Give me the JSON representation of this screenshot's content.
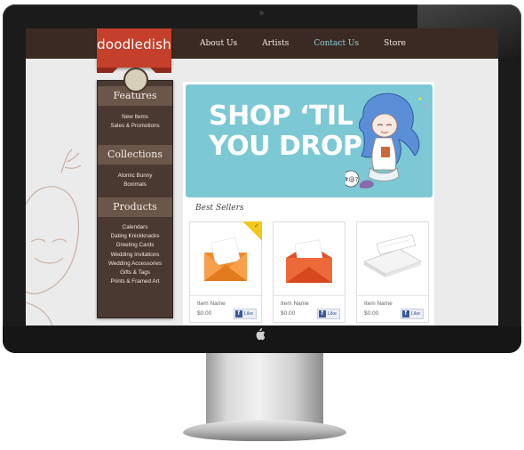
{
  "brand": {
    "logo_text": "doodledish"
  },
  "nav": {
    "items": [
      "About Us",
      "Artists",
      "Contact Us",
      "Store"
    ],
    "active": "Contact Us"
  },
  "sidebar": {
    "sections": [
      {
        "title": "Features",
        "items": [
          "New Items",
          "Sales & Promotions"
        ]
      },
      {
        "title": "Collections",
        "items": [
          "Atomic Bunny",
          "Boximals"
        ]
      },
      {
        "title": "Products",
        "items": [
          "Calendars",
          "Dating Knickknacks",
          "Greeting Cards",
          "Wedding Invitations",
          "Wedding Accessories",
          "Gifts & Tags",
          "Prints & Framed Art"
        ]
      }
    ]
  },
  "banner": {
    "line1": "SHOP ‘TIL",
    "line2": "YOU DROP"
  },
  "main": {
    "section_title": "Best Sellers",
    "products": [
      {
        "name": "Item Name",
        "price": "$0.00",
        "like": "Like",
        "image": "orange-envelope-open"
      },
      {
        "name": "Item Name",
        "price": "$0.00",
        "like": "Like",
        "image": "red-envelope-open"
      },
      {
        "name": "Item Name",
        "price": "$0.00",
        "like": "Like",
        "image": "white-envelope"
      }
    ]
  },
  "colors": {
    "nav_bg": "#3a2a23",
    "ribbon": "#c4402a",
    "active_link": "#8fd3df",
    "sidebar_bg": "#4a3930",
    "banner_bg": "#7cc8d4",
    "badge": "#f2c81a"
  }
}
